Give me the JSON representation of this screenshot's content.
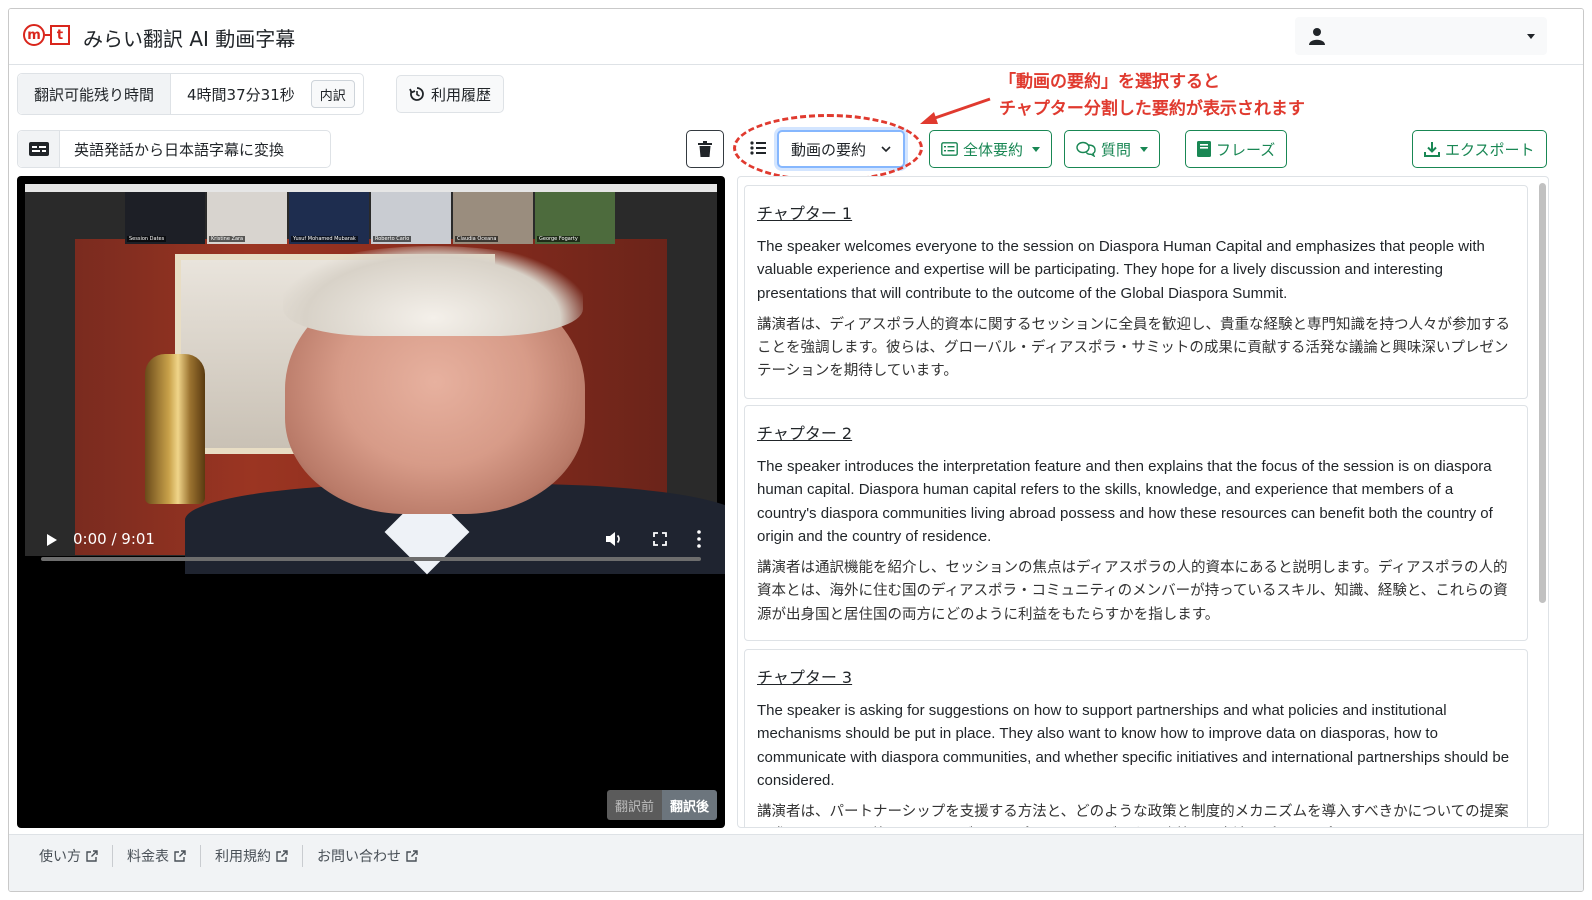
{
  "app": {
    "title": "みらい翻訳 AI 動画字幕",
    "logo_m": "m",
    "logo_t": "t"
  },
  "quota": {
    "label": "翻訳可能残り時間",
    "value": "4時間37分31秒",
    "breakdown_button": "内訳"
  },
  "history_button": "利用履歴",
  "mode": {
    "label": "英語発話から日本語字幕に変換"
  },
  "toolbar": {
    "summary_select_value": "動画の要約",
    "full_summary": "全体要約",
    "question": "質問",
    "phrase": "フレーズ",
    "export": "エクスポート"
  },
  "annotation": {
    "line1": "「動画の要約」を選択すると",
    "line2": "チャプター分割した要約が表示されます"
  },
  "video": {
    "time": "0:00 / 9:01",
    "progress": 0.0,
    "toggle_before": "翻訳前",
    "toggle_after": "翻訳後",
    "thumbnails": [
      "Session Dates",
      "Kristine Zara",
      "Yusuf Mohamed Mubarak",
      "Roberto Carlo",
      "Claudia Oceana",
      "George Fogarty"
    ]
  },
  "chapters": [
    {
      "title": "チャプター 1",
      "en": "The speaker welcomes everyone to the session on Diaspora Human Capital and emphasizes that people with valuable experience and expertise will be participating. They hope for a lively discussion and interesting presentations that will contribute to the outcome of the Global Diaspora Summit.",
      "ja": "講演者は、ディアスポラ人的資本に関するセッションに全員を歓迎し、貴重な経験と専門知識を持つ人々が参加することを強調します。彼らは、グローバル・ディアスポラ・サミットの成果に貢献する活発な議論と興味深いプレゼンテーションを期待しています。"
    },
    {
      "title": "チャプター 2",
      "en": "The speaker introduces the interpretation feature and then explains that the focus of the session is on diaspora human capital. Diaspora human capital refers to the skills, knowledge, and experience that members of a country's diaspora communities living abroad possess and how these resources can benefit both the country of origin and the country of residence.",
      "ja": "講演者は通訳機能を紹介し、セッションの焦点はディアスポラの人的資本にあると説明します。ディアスポラの人的資本とは、海外に住む国のディアスポラ・コミュニティのメンバーが持っているスキル、知識、経験と、これらの資源が出身国と居住国の両方にどのように利益をもたらすかを指します。"
    },
    {
      "title": "チャプター 3",
      "en": "The speaker is asking for suggestions on how to support partnerships and what policies and institutional mechanisms should be put in place. They also want to know how to improve data on diasporas, how to communicate with diaspora communities, and whether specific initiatives and international partnerships should be considered.",
      "ja": "講演者は、パートナーシップを支援する方法と、どのような政策と制度的メカニズムを導入すべきかについての提案を求めています。彼らはまた、ディアスポラに関するデータを改善する方法、ディアスポラのコミ"
    }
  ],
  "footer": {
    "links": [
      "使い方",
      "料金表",
      "利用規約",
      "お問い合わせ"
    ]
  },
  "colors": {
    "brand_red": "#d9261c",
    "accent_green": "#198754",
    "annotation_red": "#e03a2f"
  }
}
